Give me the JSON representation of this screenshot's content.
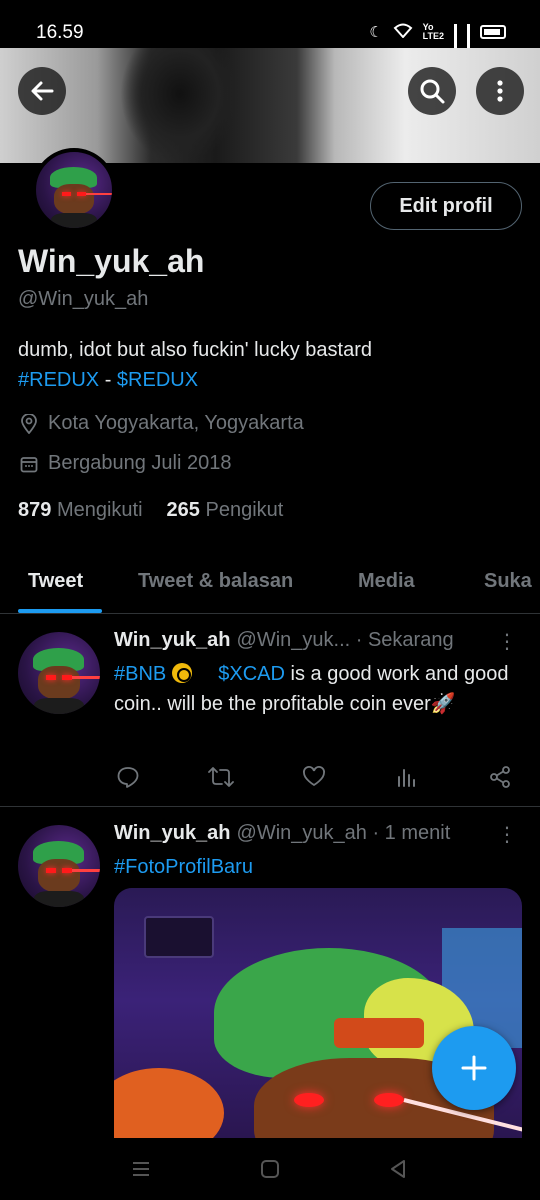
{
  "status": {
    "time": "16.59",
    "net_label_top": "Yo",
    "net_label_bottom": "LTE2"
  },
  "profile": {
    "edit_label": "Edit profil",
    "display_name": "Win_yuk_ah",
    "handle": "@Win_yuk_ah",
    "bio_line1": "dumb, idot but also fuckin' lucky bastard",
    "bio_tag1": "#REDUX",
    "bio_sep": " - ",
    "bio_tag2": "$REDUX",
    "location": "Kota Yogyakarta, Yogyakarta",
    "joined": "Bergabung Juli 2018",
    "following_count": "879",
    "following_label": "Mengikuti",
    "followers_count": "265",
    "followers_label": "Pengikut"
  },
  "tabs": [
    {
      "label": "Tweet"
    },
    {
      "label": "Tweet & balasan"
    },
    {
      "label": "Media"
    },
    {
      "label": "Suka"
    }
  ],
  "tweets": [
    {
      "name": "Win_yuk_ah",
      "handle_time": "@Win_yuk... · Sekarang",
      "tag1": "#BNB",
      "tag2": "$XCAD",
      "text_rest": " is a good work and good coin.. will be the profitable coin ever🚀"
    },
    {
      "name": "Win_yuk_ah",
      "handle_time": "@Win_yuk_ah · 1 menit",
      "tag1": "#FotoProfilBaru"
    }
  ],
  "colors": {
    "accent": "#1d9bf0",
    "background": "#000000",
    "muted": "#71767b",
    "divider": "#2f3336"
  },
  "icons": [
    "back-arrow-icon",
    "search-icon",
    "more-vertical-icon",
    "location-pin-icon",
    "calendar-icon",
    "reply-icon",
    "retweet-icon",
    "like-icon",
    "analytics-icon",
    "share-icon",
    "plus-icon"
  ]
}
